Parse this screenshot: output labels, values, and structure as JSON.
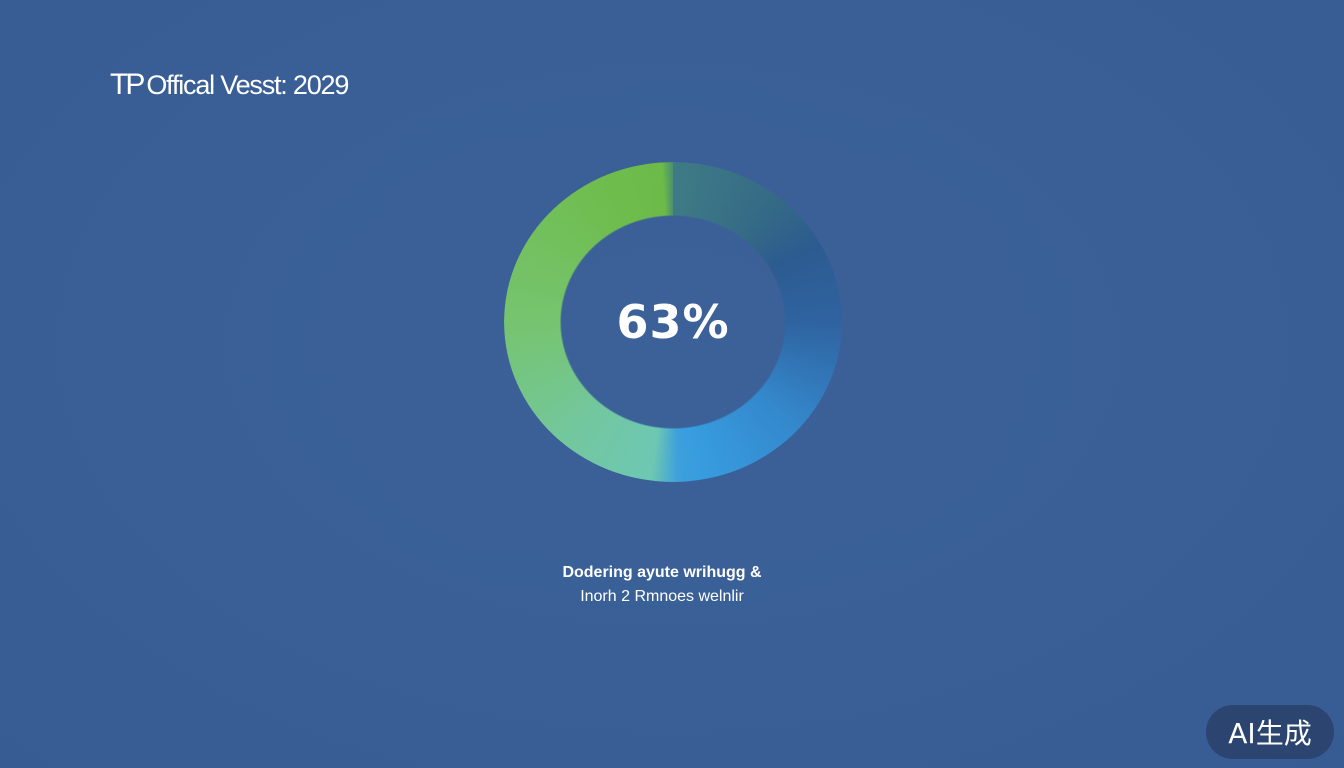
{
  "header": {
    "brand_mark": "TP",
    "brand_text": "Offical Vesst: 2029"
  },
  "progress_ring": {
    "value_label": "63%",
    "value": 63
  },
  "caption": {
    "line1": "Dodering ayute wrihugg &",
    "line2": "Inorh 2 Rmnoes welnlir"
  },
  "badge": {
    "label": "AI生成"
  }
}
